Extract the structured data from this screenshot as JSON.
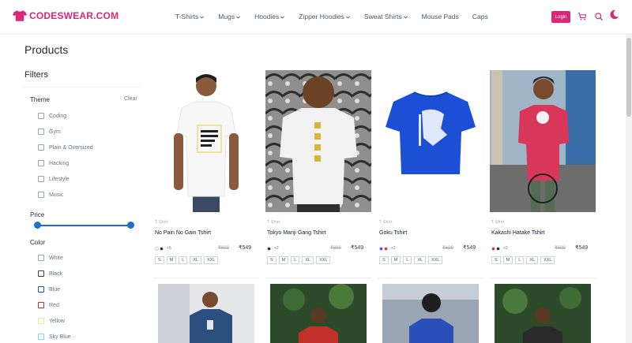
{
  "brand": {
    "name": "CODESWEAR.COM",
    "color": "#db2777"
  },
  "nav": {
    "items": [
      {
        "label": "T-Shirts",
        "dropdown": true
      },
      {
        "label": "Mugs",
        "dropdown": true
      },
      {
        "label": "Hoodies",
        "dropdown": true
      },
      {
        "label": "Zipper Hoodies",
        "dropdown": true
      },
      {
        "label": "Sweat Shirts",
        "dropdown": true
      },
      {
        "label": "Mouse Pads",
        "dropdown": false
      },
      {
        "label": "Caps",
        "dropdown": false
      }
    ],
    "login_label": "Login",
    "icons": [
      "cart-icon",
      "search-icon",
      "dark-mode-icon"
    ]
  },
  "page": {
    "title": "Products"
  },
  "filters": {
    "title": "Filters",
    "theme": {
      "label": "Theme",
      "clear_label": "Clear",
      "options": [
        "Coding",
        "Gym",
        "Plain & Oversized",
        "Hacking",
        "Lifestyle",
        "Music"
      ]
    },
    "price": {
      "label": "Price",
      "range_min_fraction": 0,
      "range_max_fraction": 1
    },
    "color": {
      "label": "Color",
      "options": [
        {
          "name": "White",
          "swatch": "#9ca3af"
        },
        {
          "name": "Black",
          "swatch": "#111827"
        },
        {
          "name": "Blue",
          "swatch": "#1d4ed8"
        },
        {
          "name": "Red",
          "swatch": "#dc2626"
        },
        {
          "name": "Yellow",
          "swatch": "#fde68a"
        },
        {
          "name": "Sky Blue",
          "swatch": "#7dd3fc"
        }
      ]
    }
  },
  "products": [
    {
      "category": "T-Shirt",
      "title": "No Pain No Gain Tshirt",
      "colors": [
        "#ffffff",
        "#111827"
      ],
      "more_colors": "+5",
      "mrp": "₹699",
      "price": "₹549",
      "sizes": [
        "S",
        "M",
        "L",
        "XL",
        "XXL"
      ],
      "image": "white-tshirt-model"
    },
    {
      "category": "T-Shirt",
      "title": "Tokyo Manji Gang Tshirt",
      "colors": [
        "#111827"
      ],
      "more_colors": "+2",
      "mrp": "₹699",
      "price": "₹549",
      "sizes": [
        "S",
        "M",
        "L",
        "XL",
        "XXL"
      ],
      "image": "white-tshirt-back-graffiti"
    },
    {
      "category": "T-Shirt",
      "title": "Goku Tshirt",
      "colors": [
        "#1d4ed8",
        "#dc2626"
      ],
      "more_colors": "+2",
      "mrp": "₹699",
      "price": "₹549",
      "sizes": [
        "S",
        "M",
        "L",
        "XL",
        "XXL"
      ],
      "image": "blue-tshirt-goku"
    },
    {
      "category": "T-Shirt",
      "title": "Kakashi Hatake Tshirt",
      "colors": [
        "#dc2626",
        "#111827"
      ],
      "more_colors": "+2",
      "mrp": "₹699",
      "price": "₹549",
      "sizes": [
        "S",
        "M",
        "L",
        "XL",
        "XXL"
      ],
      "image": "red-tshirt-model-bike"
    }
  ]
}
